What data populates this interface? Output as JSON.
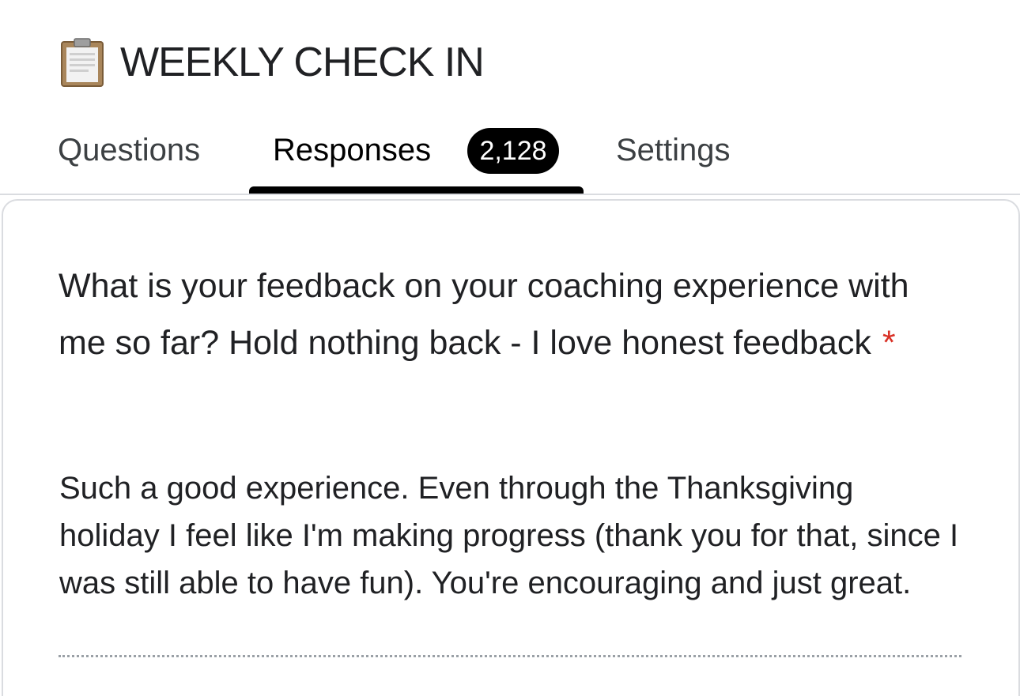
{
  "header": {
    "icon": "clipboard-icon",
    "title": "WEEKLY CHECK IN"
  },
  "tabs": [
    {
      "label": "Questions",
      "active": false
    },
    {
      "label": "Responses",
      "active": true,
      "badge": "2,128"
    },
    {
      "label": "Settings",
      "active": false
    }
  ],
  "question": {
    "text": "What is your feedback on your coaching experience with me so far? Hold nothing back - I love honest feedback",
    "required_marker": "*"
  },
  "answer": {
    "text": "Such a good experience. Even through the Thanksgiving holiday I feel like I'm making progress (thank you for that, since I was still able to have fun). You're encouraging and just great."
  },
  "colors": {
    "active_tab": "#000000",
    "required": "#d93025",
    "divider": "#dadce0"
  }
}
